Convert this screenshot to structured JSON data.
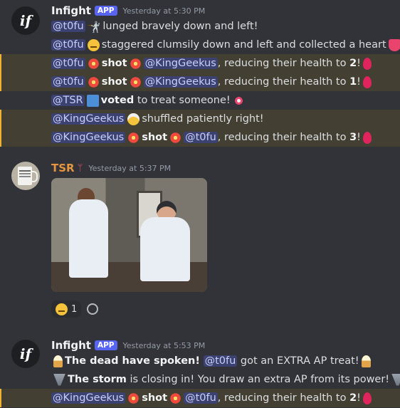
{
  "messages": [
    {
      "author": "Infight",
      "badge": "APP",
      "timestamp": "Yesterday at 5:30 PM",
      "lines": [
        {
          "mention": "@t0fu",
          "text": "lunged bravely down and left!"
        },
        {
          "mention": "@t0fu",
          "text": "staggered clumsily down and left and collected a heart"
        },
        {
          "mention": "@t0fu",
          "action": "shot",
          "target": "@KingGeekus",
          "text": ", reducing their health to ",
          "value": "2",
          "end": "!"
        },
        {
          "mention": "@t0fu",
          "action": "shot",
          "target": "@KingGeekus",
          "text": ", reducing their health to ",
          "value": "1",
          "end": "!"
        },
        {
          "mention": "@TSR",
          "action": "voted",
          "text": "to treat someone!"
        },
        {
          "mention": "@KingGeekus",
          "text": "shuffled patiently right!"
        },
        {
          "mention": "@KingGeekus",
          "action": "shot",
          "target": "@t0fu",
          "text": ", reducing their health to ",
          "value": "3",
          "end": "!"
        }
      ]
    },
    {
      "author": "TSR",
      "timestamp": "Yesterday at 5:37 PM",
      "reaction": {
        "emoji": "grin",
        "count": "1"
      }
    },
    {
      "author": "Infight",
      "badge": "APP",
      "timestamp": "Yesterday at 5:53 PM",
      "lines": [
        {
          "bold": "The dead have spoken!",
          "mention": "@t0fu",
          "text": "got an EXTRA AP treat!"
        },
        {
          "bold": "The storm",
          "text": "is closing in! You draw an extra AP from its power!"
        },
        {
          "mention": "@KingGeekus",
          "action": "shot",
          "target": "@t0fu",
          "text": ", reducing their health to ",
          "value": "2",
          "end": "!"
        }
      ]
    }
  ],
  "colors": {
    "background": "#313338",
    "highlight": "#443f33",
    "mention_bg": "#3c4270",
    "badge": "#5865f2",
    "tsr_name": "#e5963e"
  },
  "icons": [
    "infight-logo",
    "fencer-emoji",
    "woozy-face-emoji",
    "collision-emoji",
    "heart-emoji",
    "blood-drop-emoji",
    "ballot-box-emoji",
    "candy-emoji",
    "old-man-emoji",
    "ice-cream-emoji",
    "tornado-emoji",
    "grin-emoji",
    "add-reaction-icon"
  ]
}
